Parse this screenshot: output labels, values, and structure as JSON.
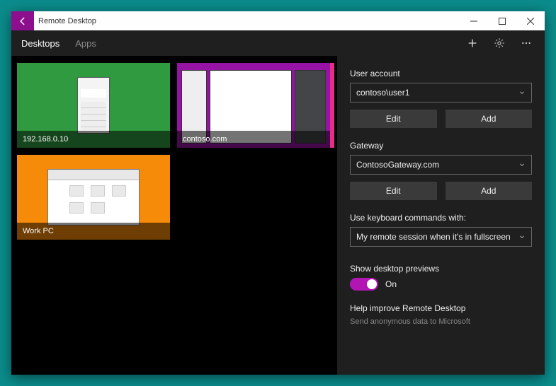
{
  "title": "Remote Desktop",
  "tabs": {
    "desktops": "Desktops",
    "apps": "Apps"
  },
  "tiles": [
    {
      "label": "192.168.0.10"
    },
    {
      "label": "contoso.com"
    },
    {
      "label": "Work PC"
    }
  ],
  "panel": {
    "user_account": {
      "label": "User account",
      "value": "contoso\\user1",
      "edit": "Edit",
      "add": "Add"
    },
    "gateway": {
      "label": "Gateway",
      "value": "ContosoGateway.com",
      "edit": "Edit",
      "add": "Add"
    },
    "keyboard": {
      "label": "Use keyboard commands with:",
      "value": "My remote session when it's in fullscreen"
    },
    "previews": {
      "label": "Show desktop previews",
      "state": "On"
    },
    "help": {
      "title": "Help improve Remote Desktop",
      "subtitle": "Send anonymous data to Microsoft"
    }
  }
}
